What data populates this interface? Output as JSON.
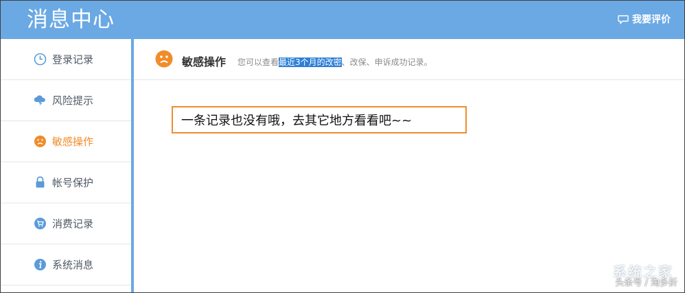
{
  "header": {
    "title": "消息中心",
    "feedback_label": "我要评价",
    "feedback_icon": "speech-bubble-icon"
  },
  "sidebar": {
    "items": [
      {
        "label": "登录记录",
        "icon": "clock-icon",
        "active": false
      },
      {
        "label": "风险提示",
        "icon": "cloud-lightning-icon",
        "active": false
      },
      {
        "label": "敏感操作",
        "icon": "sad-face-icon",
        "active": true
      },
      {
        "label": "帐号保护",
        "icon": "lock-icon",
        "active": false
      },
      {
        "label": "消费记录",
        "icon": "cart-icon",
        "active": false
      },
      {
        "label": "系统消息",
        "icon": "info-icon",
        "active": false
      }
    ]
  },
  "main": {
    "section_title": "敏感操作",
    "section_icon": "sad-face-icon",
    "desc_prefix": "您可以查看",
    "desc_highlight": "最近3个月的改密",
    "desc_suffix": "、改保、申诉成功记录。",
    "empty_message": "一条记录也没有哦，去其它地方看看吧~~"
  },
  "watermark": {
    "logo_text": "系统之家",
    "source_text": "头条号 / 淘多折"
  },
  "colors": {
    "header_bg": "#6aa9e4",
    "accent_orange": "#f08c2a",
    "icon_blue": "#5b9bd9",
    "selection_blue": "#2f7fd6"
  }
}
